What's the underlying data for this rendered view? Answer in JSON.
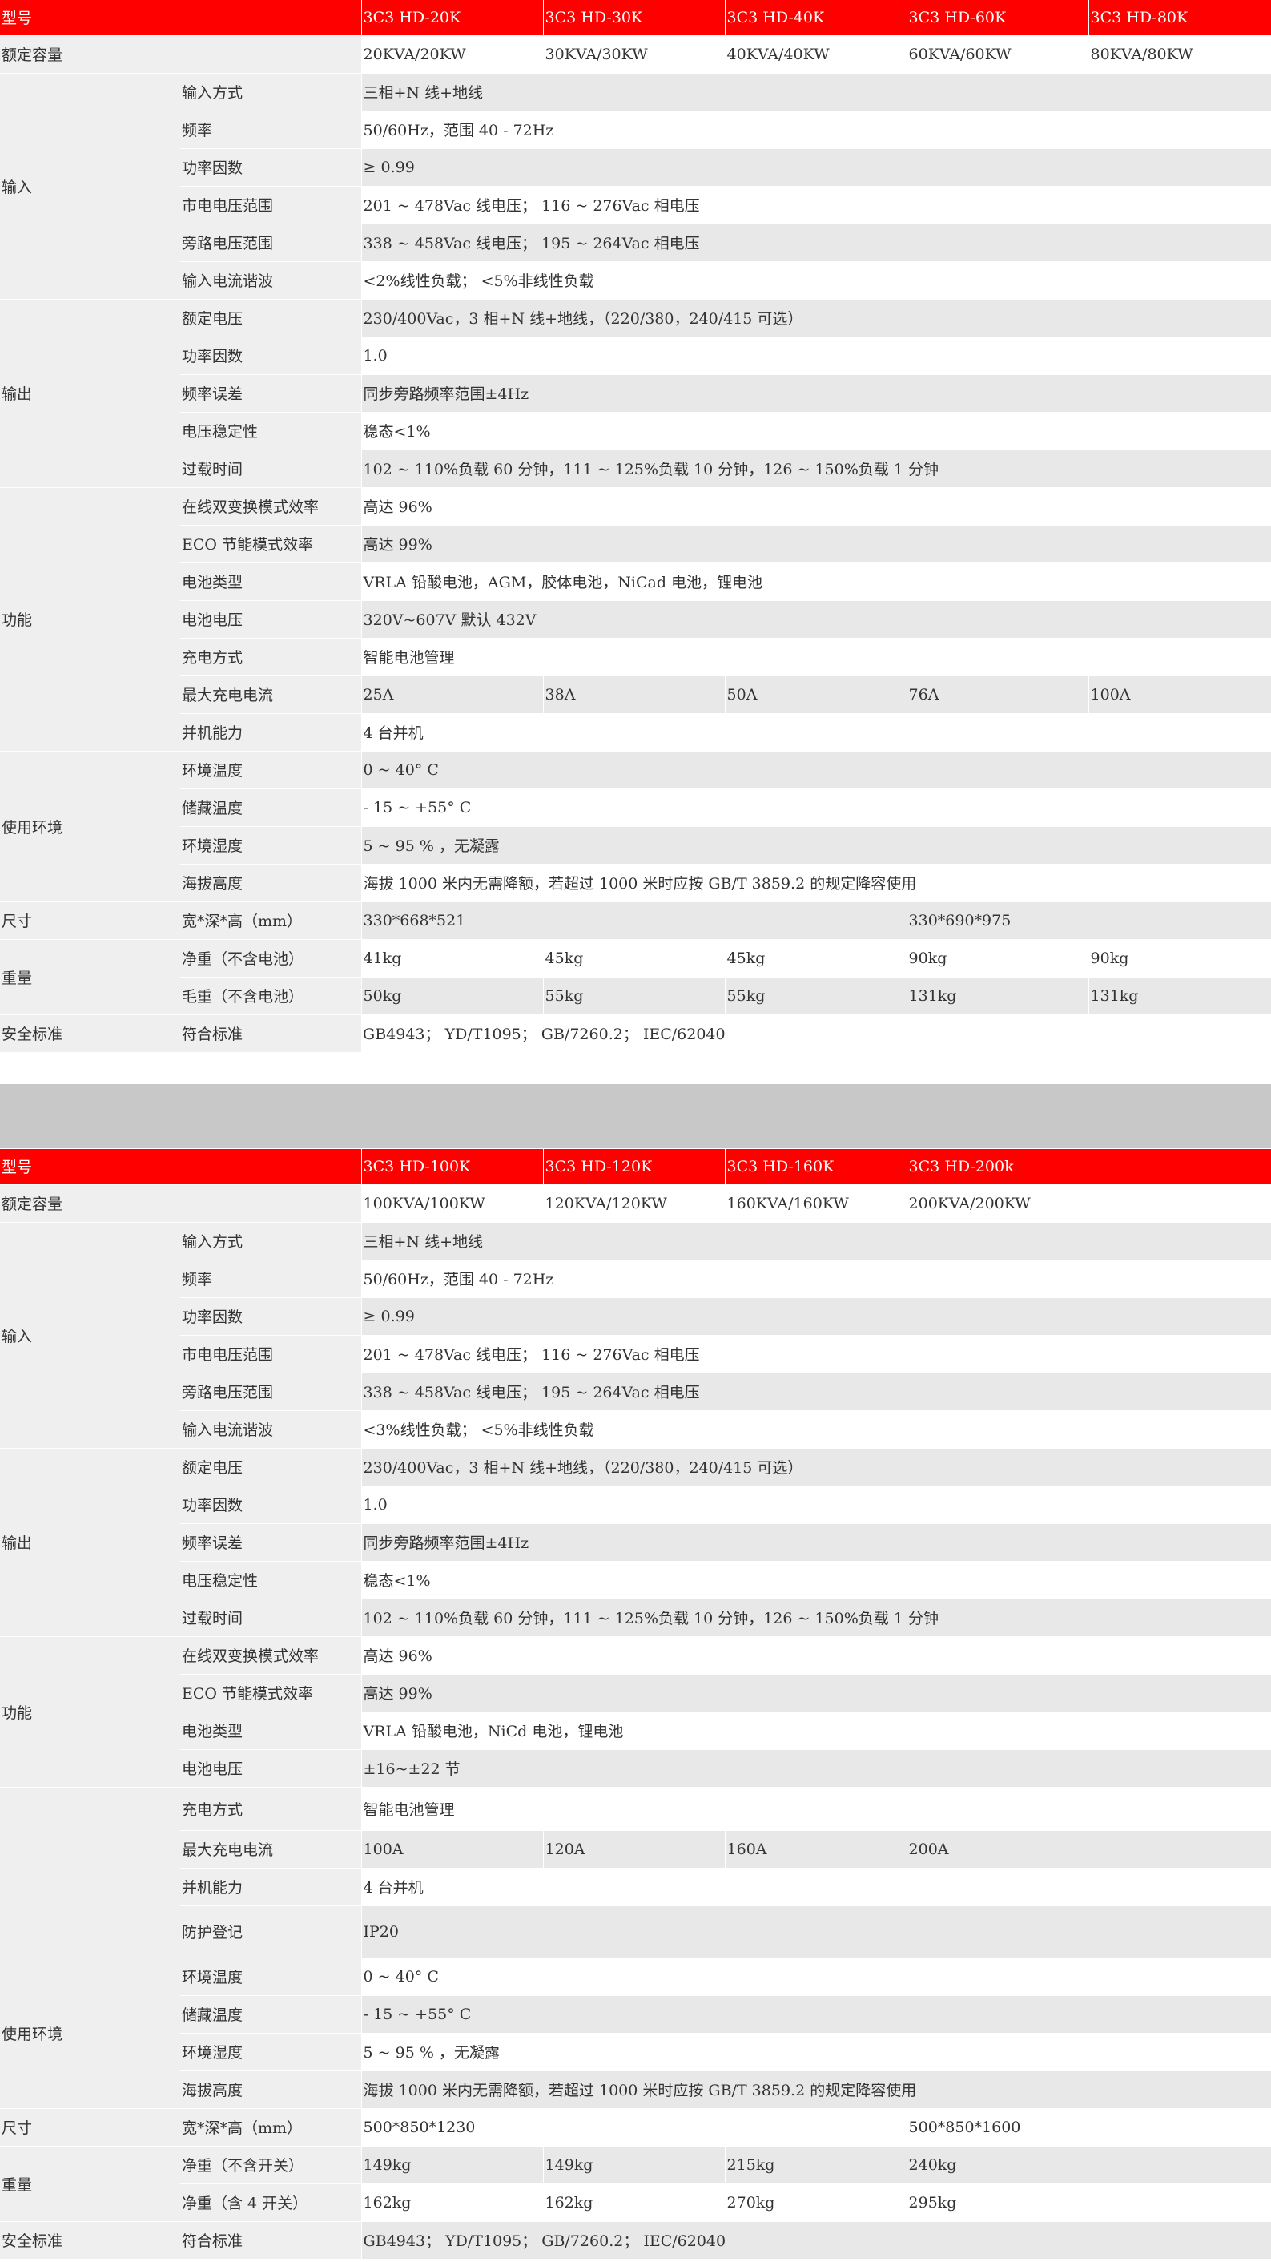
{
  "table1": {
    "header": [
      "型号",
      "3C3 HD-20K",
      "3C3 HD-30K",
      "3C3 HD-40K",
      "3C3 HD-60K",
      "3C3 HD-80K"
    ],
    "rated_capacity": {
      "label": "额定容量",
      "values": [
        "20KVA/20KW",
        "30KVA/30KW",
        "40KVA/40KW",
        "60KVA/60KW",
        "80KVA/80KW"
      ]
    },
    "input": {
      "label": "输入",
      "rows": [
        {
          "label": "输入方式",
          "value": "三相+N 线+地线"
        },
        {
          "label": "频率",
          "value": "50/60Hz，范围 40 - 72Hz"
        },
        {
          "label": "功率因数",
          "value": "≥ 0.99"
        },
        {
          "label": "市电电压范围",
          "value": "201 ~ 478Vac 线电压； 116 ~ 276Vac 相电压"
        },
        {
          "label": "旁路电压范围",
          "value": "338 ~ 458Vac 线电压； 195 ~ 264Vac 相电压"
        },
        {
          "label": "输入电流谐波",
          "value": "<2%线性负载； <5%非线性负载"
        }
      ]
    },
    "output": {
      "label": "输出",
      "rows": [
        {
          "label": "额定电压",
          "value": "230/400Vac，3 相+N 线+地线，（220/380，240/415 可选）"
        },
        {
          "label": "功率因数",
          "value": "1.0"
        },
        {
          "label": "频率误差",
          "value": "同步旁路频率范围±4Hz"
        },
        {
          "label": "电压稳定性",
          "value": "稳态<1%"
        },
        {
          "label": "过载时间",
          "value": "102 ~ 110%负载 60 分钟，111 ~ 125%负载 10 分钟，126 ~ 150%负载 1 分钟"
        }
      ]
    },
    "function": {
      "label": "功能",
      "rows": [
        {
          "label": "在线双变换模式效率",
          "value": "高达 96%"
        },
        {
          "label": "ECO 节能模式效率",
          "value": "高达 99%"
        },
        {
          "label": "电池类型",
          "value": "VRLA 铅酸电池，AGM，胶体电池，NiCad 电池，锂电池"
        },
        {
          "label": "电池电压",
          "value": "320V~607V 默认 432V"
        },
        {
          "label": "充电方式",
          "value": "智能电池管理"
        }
      ],
      "max_charge": {
        "label": "最大充电电流",
        "values": [
          "25A",
          "38A",
          "50A",
          "76A",
          "100A"
        ]
      },
      "parallel": {
        "label": "并机能力",
        "value": "4 台并机"
      }
    },
    "environment": {
      "label": "使用环境",
      "rows": [
        {
          "label": "环境温度",
          "value": "0 ~ 40° C"
        },
        {
          "label": "储藏温度",
          "value": "- 15 ~ +55° C"
        },
        {
          "label": "环境湿度",
          "value": "5 ~ 95 % ，无凝露"
        },
        {
          "label": "海拔高度",
          "value": "海拔 1000 米内无需降额，若超过 1000 米时应按 GB/T 3859.2 的规定降容使用"
        }
      ]
    },
    "size": {
      "label": "尺寸",
      "sublabel": "宽*深*高（mm）",
      "value_a": "330*668*521",
      "value_b": "330*690*975"
    },
    "weight": {
      "label": "重量",
      "net": {
        "label": "净重（不含电池）",
        "values": [
          "41kg",
          "45kg",
          "45kg",
          "90kg",
          "90kg"
        ]
      },
      "gross": {
        "label": "毛重（不含电池）",
        "values": [
          "50kg",
          "55kg",
          "55kg",
          "131kg",
          "131kg"
        ]
      }
    },
    "safety": {
      "label": "安全标准",
      "sublabel": "符合标准",
      "value": "GB4943； YD/T1095； GB/7260.2； IEC/62040"
    }
  },
  "table2": {
    "header": [
      "型号",
      "3C3 HD-100K",
      "3C3 HD-120K",
      "3C3 HD-160K",
      "3C3 HD-200k"
    ],
    "rated_capacity": {
      "label": "额定容量",
      "values": [
        "100KVA/100KW",
        "120KVA/120KW",
        "160KVA/160KW",
        "200KVA/200KW"
      ]
    },
    "input": {
      "label": "输入",
      "rows": [
        {
          "label": "输入方式",
          "value": "三相+N 线+地线"
        },
        {
          "label": "频率",
          "value": "50/60Hz，范围 40 - 72Hz"
        },
        {
          "label": "功率因数",
          "value": "≥ 0.99"
        },
        {
          "label": "市电电压范围",
          "value": "201 ~ 478Vac 线电压； 116 ~ 276Vac 相电压"
        },
        {
          "label": "旁路电压范围",
          "value": "338 ~ 458Vac 线电压； 195 ~ 264Vac 相电压"
        },
        {
          "label": "输入电流谐波",
          "value": "<3%线性负载； <5%非线性负载"
        }
      ]
    },
    "output": {
      "label": "输出",
      "rows": [
        {
          "label": "额定电压",
          "value": "230/400Vac，3 相+N 线+地线，（220/380，240/415 可选）"
        },
        {
          "label": "功率因数",
          "value": "1.0"
        },
        {
          "label": "频率误差",
          "value": "同步旁路频率范围±4Hz"
        },
        {
          "label": "电压稳定性",
          "value": "稳态<1%"
        },
        {
          "label": "过载时间",
          "value": "102 ~ 110%负载 60 分钟，111 ~ 125%负载 10 分钟，126 ~ 150%负载 1 分钟"
        }
      ]
    },
    "function": {
      "label": "功能",
      "rows": [
        {
          "label": "在线双变换模式效率",
          "value": "高达 96%"
        },
        {
          "label": "ECO 节能模式效率",
          "value": "高达 99%"
        },
        {
          "label": "电池类型",
          "value": "VRLA 铅酸电池，NiCd 电池，锂电池"
        },
        {
          "label": "电池电压",
          "value": "±16~±22 节"
        }
      ]
    },
    "function2": {
      "charge": {
        "label": "充电方式",
        "value": "智能电池管理"
      },
      "max_charge": {
        "label": "最大充电电流",
        "values": [
          "100A",
          "120A",
          "160A",
          "200A"
        ]
      },
      "parallel": {
        "label": "并机能力",
        "value": "4 台并机"
      },
      "protection": {
        "label": "防护登记",
        "value": "IP20"
      }
    },
    "environment": {
      "label": "使用环境",
      "rows": [
        {
          "label": "环境温度",
          "value": "0 ~ 40° C"
        },
        {
          "label": "储藏温度",
          "value": "- 15 ~ +55° C"
        },
        {
          "label": "环境湿度",
          "value": "5 ~ 95 % ，无凝露"
        },
        {
          "label": "海拔高度",
          "value": "海拔 1000 米内无需降额，若超过 1000 米时应按 GB/T 3859.2 的规定降容使用"
        }
      ]
    },
    "size": {
      "label": "尺寸",
      "sublabel": "宽*深*高（mm）",
      "value_a": "500*850*1230",
      "value_b": "500*850*1600"
    },
    "weight": {
      "label": "重量",
      "net": {
        "label": "净重（不含开关）",
        "values": [
          "149kg",
          "149kg",
          "215kg",
          "240kg"
        ]
      },
      "gross": {
        "label": "净重（含 4 开关）",
        "values": [
          "162kg",
          "162kg",
          "270kg",
          "295kg"
        ]
      }
    },
    "safety": {
      "label": "安全标准",
      "sublabel": "符合标准",
      "value": "GB4943； YD/T1095； GB/7260.2； IEC/62040"
    }
  },
  "colors": {
    "header_bg": "#ff0000",
    "header_text": "#ffffff",
    "row_gray": "#e8e8e8",
    "label_gray": "#efefef",
    "separator": "#c8c8c8"
  }
}
